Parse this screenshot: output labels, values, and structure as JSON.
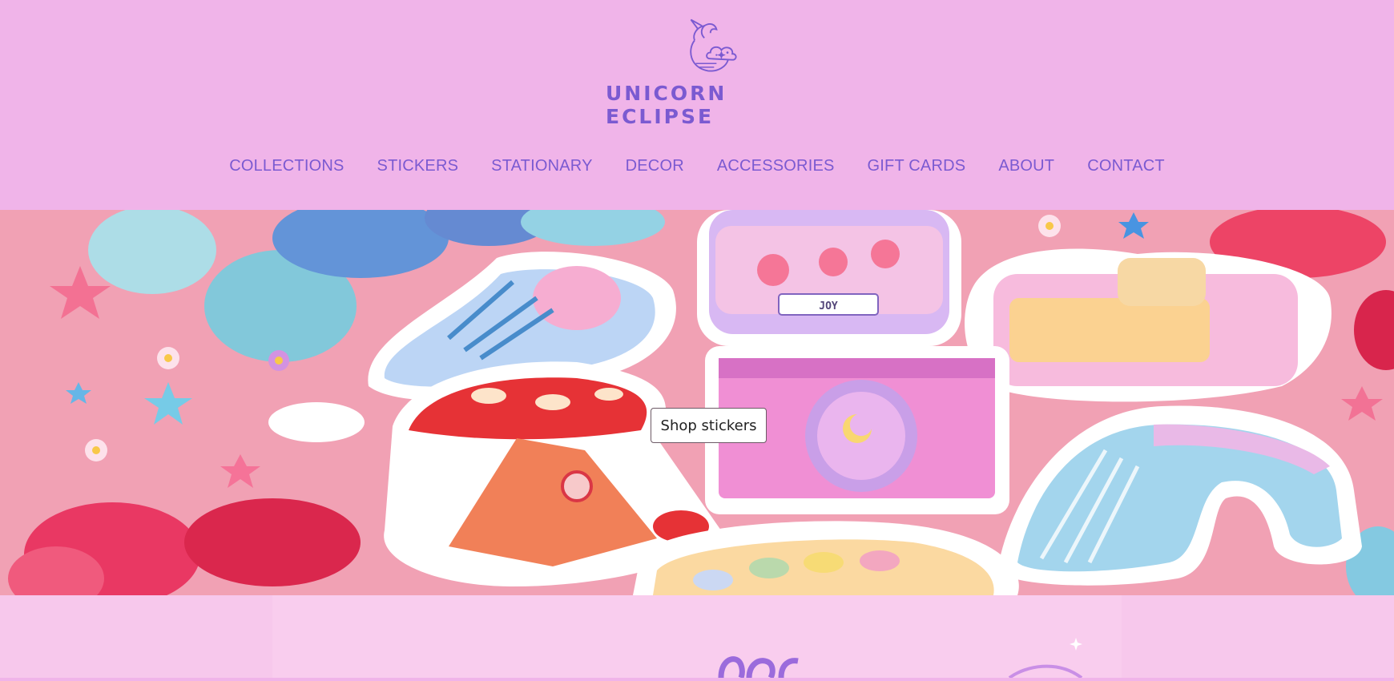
{
  "brand": {
    "name": "UNICORN ECLIPSE",
    "logo_icon": "unicorn-moon-cloud-icon"
  },
  "nav": {
    "items": [
      {
        "label": "COLLECTIONS"
      },
      {
        "label": "STICKERS"
      },
      {
        "label": "STATIONARY"
      },
      {
        "label": "DECOR"
      },
      {
        "label": "ACCESSORIES"
      },
      {
        "label": "GIFT CARDS"
      },
      {
        "label": "ABOUT"
      },
      {
        "label": "CONTACT"
      }
    ]
  },
  "hero": {
    "cta_label": "Shop stickers",
    "sticker_label": "JOY"
  },
  "colors": {
    "header_bg": "#f0b4e9",
    "accent": "#7b5ad1",
    "hero_bg": "#f19cb0",
    "section_bg": "#f7c8ec"
  }
}
